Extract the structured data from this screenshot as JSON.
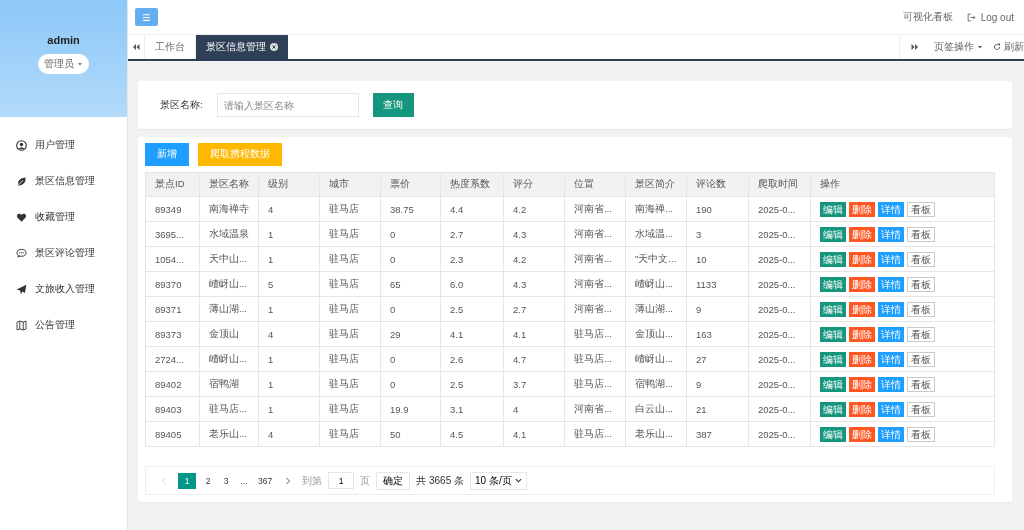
{
  "sidebar": {
    "user": "admin",
    "role": "管理员",
    "items": [
      {
        "label": "用户管理",
        "selected": false
      },
      {
        "label": "景区信息管理",
        "selected": false
      },
      {
        "label": "收藏管理",
        "selected": false
      },
      {
        "label": "景区评论管理",
        "selected": false
      },
      {
        "label": "文旅收入管理",
        "selected": false
      },
      {
        "label": "公告管理",
        "selected": false
      }
    ]
  },
  "header": {
    "links": [
      "可视化看板",
      "Log out"
    ]
  },
  "tabs": {
    "items": [
      {
        "label": "工作台",
        "selected": false,
        "closable": false
      },
      {
        "label": "景区信息管理",
        "selected": true,
        "closable": true
      }
    ],
    "page_actions": "页签操作",
    "refresh": "刷新"
  },
  "search": {
    "label": "景区名称:",
    "placeholder": "请输入景区名称",
    "button": "查询"
  },
  "toolbar": [
    {
      "label": "新增",
      "kind": "primary"
    },
    {
      "label": "爬取携程数据",
      "kind": "warning"
    }
  ],
  "table": {
    "columns": [
      "景点ID",
      "景区名称",
      "级别",
      "城市",
      "票价",
      "热度系数",
      "评分",
      "位置",
      "景区简介",
      "评论数",
      "爬取时间",
      "操作"
    ],
    "rows": [
      {
        "cells": [
          "89349",
          "南海禅寺",
          "4",
          "驻马店",
          "38.75",
          "4.4",
          "4.2",
          "河南省...",
          "南海禅...",
          "190",
          "2025-0..."
        ],
        "actions": [
          {
            "label": "编辑",
            "kind": "edit"
          },
          {
            "label": "删除",
            "kind": "delete"
          },
          {
            "label": "详情",
            "kind": "detail"
          },
          {
            "label": "看板",
            "kind": "board"
          }
        ]
      },
      {
        "cells": [
          "3695...",
          "水域温泉",
          "1",
          "驻马店",
          "0",
          "2.7",
          "4.3",
          "河南省...",
          "水域温...",
          "3",
          "2025-0..."
        ],
        "actions": [
          {
            "label": "编辑",
            "kind": "edit"
          },
          {
            "label": "删除",
            "kind": "delete"
          },
          {
            "label": "详情",
            "kind": "detail"
          },
          {
            "label": "看板",
            "kind": "board"
          }
        ]
      },
      {
        "cells": [
          "1054...",
          "天中山...",
          "1",
          "驻马店",
          "0",
          "2.3",
          "4.2",
          "河南省...",
          "\"天中文...",
          "10",
          "2025-0..."
        ],
        "actions": [
          {
            "label": "编辑",
            "kind": "edit"
          },
          {
            "label": "删除",
            "kind": "delete"
          },
          {
            "label": "详情",
            "kind": "detail"
          },
          {
            "label": "看板",
            "kind": "board"
          }
        ]
      },
      {
        "cells": [
          "89370",
          "嵖岈山...",
          "5",
          "驻马店",
          "65",
          "6.0",
          "4.3",
          "河南省...",
          "嵖岈山...",
          "1133",
          "2025-0..."
        ],
        "actions": [
          {
            "label": "编辑",
            "kind": "edit"
          },
          {
            "label": "删除",
            "kind": "delete"
          },
          {
            "label": "详情",
            "kind": "detail"
          },
          {
            "label": "看板",
            "kind": "board"
          }
        ]
      },
      {
        "cells": [
          "89371",
          "薄山湖...",
          "1",
          "驻马店",
          "0",
          "2.5",
          "2.7",
          "河南省...",
          "薄山湖...",
          "9",
          "2025-0..."
        ],
        "actions": [
          {
            "label": "编辑",
            "kind": "edit"
          },
          {
            "label": "删除",
            "kind": "delete"
          },
          {
            "label": "详情",
            "kind": "detail"
          },
          {
            "label": "看板",
            "kind": "board"
          }
        ]
      },
      {
        "cells": [
          "89373",
          "金顶山",
          "4",
          "驻马店",
          "29",
          "4.1",
          "4.1",
          "驻马店...",
          "金顶山...",
          "163",
          "2025-0..."
        ],
        "actions": [
          {
            "label": "编辑",
            "kind": "edit"
          },
          {
            "label": "删除",
            "kind": "delete"
          },
          {
            "label": "详情",
            "kind": "detail"
          },
          {
            "label": "看板",
            "kind": "board"
          }
        ]
      },
      {
        "cells": [
          "2724...",
          "嵖岈山...",
          "1",
          "驻马店",
          "0",
          "2.6",
          "4.7",
          "驻马店...",
          "嵖岈山...",
          "27",
          "2025-0..."
        ],
        "actions": [
          {
            "label": "编辑",
            "kind": "edit"
          },
          {
            "label": "删除",
            "kind": "delete"
          },
          {
            "label": "详情",
            "kind": "detail"
          },
          {
            "label": "看板",
            "kind": "board"
          }
        ]
      },
      {
        "cells": [
          "89402",
          "宿鸭湖",
          "1",
          "驻马店",
          "0",
          "2.5",
          "3.7",
          "驻马店...",
          "宿鸭湖...",
          "9",
          "2025-0..."
        ],
        "actions": [
          {
            "label": "编辑",
            "kind": "edit"
          },
          {
            "label": "删除",
            "kind": "delete"
          },
          {
            "label": "详情",
            "kind": "detail"
          },
          {
            "label": "看板",
            "kind": "board"
          }
        ]
      },
      {
        "cells": [
          "89403",
          "驻马店...",
          "1",
          "驻马店",
          "19.9",
          "3.1",
          "4",
          "河南省...",
          "白云山...",
          "21",
          "2025-0..."
        ],
        "actions": [
          {
            "label": "编辑",
            "kind": "edit"
          },
          {
            "label": "删除",
            "kind": "delete"
          },
          {
            "label": "详情",
            "kind": "detail"
          },
          {
            "label": "看板",
            "kind": "board"
          }
        ]
      },
      {
        "cells": [
          "89405",
          "老乐山...",
          "4",
          "驻马店",
          "50",
          "4.5",
          "4.1",
          "驻马店...",
          "老乐山...",
          "387",
          "2025-0..."
        ],
        "actions": [
          {
            "label": "编辑",
            "kind": "edit"
          },
          {
            "label": "删除",
            "kind": "delete"
          },
          {
            "label": "详情",
            "kind": "detail"
          },
          {
            "label": "看板",
            "kind": "board"
          }
        ]
      }
    ]
  },
  "pagination": {
    "pages": [
      {
        "label": "1",
        "selected": true
      },
      {
        "label": "2",
        "selected": false
      },
      {
        "label": "3",
        "selected": false
      },
      {
        "label": "...",
        "selected": false
      },
      {
        "label": "367",
        "selected": false
      }
    ],
    "goto_label": "到第",
    "goto_value": "1",
    "page_unit": "页",
    "confirm": "确定",
    "total": "共 3665 条",
    "page_size": "10 条/页"
  }
}
